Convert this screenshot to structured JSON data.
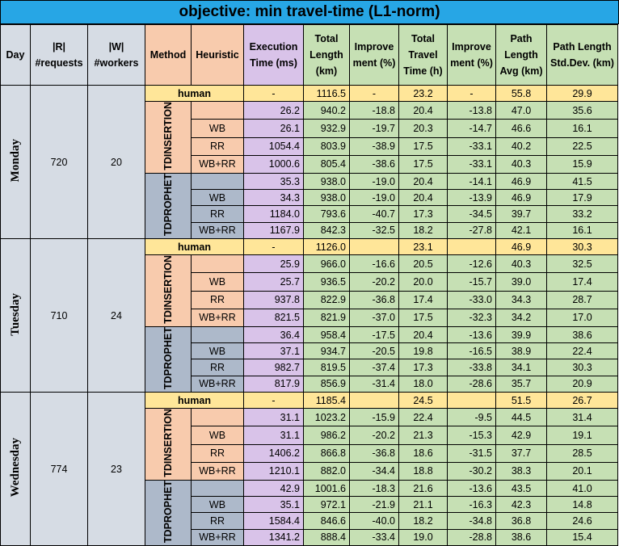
{
  "title": "objective:  min travel-time (L1-norm)",
  "headers": {
    "day": "Day",
    "requests": "|R| #requests",
    "workers": "|W| #workers",
    "method": "Method",
    "heuristic": "Heuristic",
    "exec": "Execution Time (ms)",
    "total_length": "Total Length (km)",
    "improvement_length": "Improve ment (%)",
    "total_travel": "Total Travel Time (h)",
    "improvement_time": "Improve ment (%)",
    "path_avg": "Path Length Avg (km)",
    "path_std": "Path Length Std.Dev. (km)"
  },
  "days": [
    {
      "day": "Monday",
      "requests": "720",
      "workers": "20",
      "human": {
        "label": "human",
        "exec": "-",
        "total_length": "1116.5",
        "imp_len": "-",
        "travel": "23.2",
        "imp_time": "-",
        "path_avg": "55.8",
        "path_std": "29.9"
      },
      "methods": [
        {
          "method": "TDINSERTION",
          "rows": [
            {
              "heuristic": "",
              "exec": "26.2",
              "total_length": "940.2",
              "imp_len": "-18.8",
              "travel": "20.4",
              "imp_time": "-13.8",
              "path_avg": "47.0",
              "path_std": "35.6"
            },
            {
              "heuristic": "WB",
              "exec": "26.1",
              "total_length": "932.9",
              "imp_len": "-19.7",
              "travel": "20.3",
              "imp_time": "-14.7",
              "path_avg": "46.6",
              "path_std": "16.1"
            },
            {
              "heuristic": "RR",
              "exec": "1054.4",
              "total_length": "803.9",
              "imp_len": "-38.9",
              "travel": "17.5",
              "imp_time": "-33.1",
              "path_avg": "40.2",
              "path_std": "22.5"
            },
            {
              "heuristic": "WB+RR",
              "exec": "1000.6",
              "total_length": "805.4",
              "imp_len": "-38.6",
              "travel": "17.5",
              "imp_time": "-33.1",
              "path_avg": "40.3",
              "path_std": "15.9"
            }
          ]
        },
        {
          "method": "TDPROPHET",
          "rows": [
            {
              "heuristic": "",
              "exec": "35.3",
              "total_length": "938.0",
              "imp_len": "-19.0",
              "travel": "20.4",
              "imp_time": "-14.1",
              "path_avg": "46.9",
              "path_std": "41.5"
            },
            {
              "heuristic": "WB",
              "exec": "34.3",
              "total_length": "938.0",
              "imp_len": "-19.0",
              "travel": "20.4",
              "imp_time": "-13.9",
              "path_avg": "46.9",
              "path_std": "17.9"
            },
            {
              "heuristic": "RR",
              "exec": "1184.0",
              "total_length": "793.6",
              "imp_len": "-40.7",
              "travel": "17.3",
              "imp_time": "-34.5",
              "path_avg": "39.7",
              "path_std": "33.2"
            },
            {
              "heuristic": "WB+RR",
              "exec": "1167.9",
              "total_length": "842.3",
              "imp_len": "-32.5",
              "travel": "18.2",
              "imp_time": "-27.8",
              "path_avg": "42.1",
              "path_std": "16.1"
            }
          ]
        }
      ]
    },
    {
      "day": "Tuesday",
      "requests": "710",
      "workers": "24",
      "human": {
        "label": "human",
        "exec": "-",
        "total_length": "1126.0",
        "imp_len": "",
        "travel": "23.1",
        "imp_time": "",
        "path_avg": "46.9",
        "path_std": "30.3"
      },
      "methods": [
        {
          "method": "TDINSERTION",
          "rows": [
            {
              "heuristic": "",
              "exec": "25.9",
              "total_length": "966.0",
              "imp_len": "-16.6",
              "travel": "20.5",
              "imp_time": "-12.6",
              "path_avg": "40.3",
              "path_std": "32.5"
            },
            {
              "heuristic": "WB",
              "exec": "25.7",
              "total_length": "936.5",
              "imp_len": "-20.2",
              "travel": "20.0",
              "imp_time": "-15.7",
              "path_avg": "39.0",
              "path_std": "17.4"
            },
            {
              "heuristic": "RR",
              "exec": "937.8",
              "total_length": "822.9",
              "imp_len": "-36.8",
              "travel": "17.4",
              "imp_time": "-33.0",
              "path_avg": "34.3",
              "path_std": "28.7"
            },
            {
              "heuristic": "WB+RR",
              "exec": "821.5",
              "total_length": "821.9",
              "imp_len": "-37.0",
              "travel": "17.5",
              "imp_time": "-32.3",
              "path_avg": "34.2",
              "path_std": "17.0"
            }
          ]
        },
        {
          "method": "TDPROPHET",
          "rows": [
            {
              "heuristic": "",
              "exec": "36.4",
              "total_length": "958.4",
              "imp_len": "-17.5",
              "travel": "20.4",
              "imp_time": "-13.6",
              "path_avg": "39.9",
              "path_std": "38.6"
            },
            {
              "heuristic": "WB",
              "exec": "37.1",
              "total_length": "934.7",
              "imp_len": "-20.5",
              "travel": "19.8",
              "imp_time": "-16.5",
              "path_avg": "38.9",
              "path_std": "22.4"
            },
            {
              "heuristic": "RR",
              "exec": "982.7",
              "total_length": "819.5",
              "imp_len": "-37.4",
              "travel": "17.3",
              "imp_time": "-33.8",
              "path_avg": "34.1",
              "path_std": "30.3"
            },
            {
              "heuristic": "WB+RR",
              "exec": "817.9",
              "total_length": "856.9",
              "imp_len": "-31.4",
              "travel": "18.0",
              "imp_time": "-28.6",
              "path_avg": "35.7",
              "path_std": "20.9"
            }
          ]
        }
      ]
    },
    {
      "day": "Wednesday",
      "requests": "774",
      "workers": "23",
      "human": {
        "label": "human",
        "exec": "-",
        "total_length": "1185.4",
        "imp_len": "",
        "travel": "24.5",
        "imp_time": "",
        "path_avg": "51.5",
        "path_std": "26.7"
      },
      "methods": [
        {
          "method": "TDINSERTION",
          "rows": [
            {
              "heuristic": "",
              "exec": "31.1",
              "total_length": "1023.2",
              "imp_len": "-15.9",
              "travel": "22.4",
              "imp_time": "-9.5",
              "path_avg": "44.5",
              "path_std": "31.4"
            },
            {
              "heuristic": "WB",
              "exec": "31.1",
              "total_length": "986.2",
              "imp_len": "-20.2",
              "travel": "21.3",
              "imp_time": "-15.3",
              "path_avg": "42.9",
              "path_std": "19.1"
            },
            {
              "heuristic": "RR",
              "exec": "1406.2",
              "total_length": "866.8",
              "imp_len": "-36.8",
              "travel": "18.6",
              "imp_time": "-31.5",
              "path_avg": "37.7",
              "path_std": "28.5"
            },
            {
              "heuristic": "WB+RR",
              "exec": "1210.1",
              "total_length": "882.0",
              "imp_len": "-34.4",
              "travel": "18.8",
              "imp_time": "-30.2",
              "path_avg": "38.3",
              "path_std": "20.1"
            }
          ]
        },
        {
          "method": "TDPROPHET",
          "rows": [
            {
              "heuristic": "",
              "exec": "42.9",
              "total_length": "1001.6",
              "imp_len": "-18.3",
              "travel": "21.6",
              "imp_time": "-13.6",
              "path_avg": "43.5",
              "path_std": "41.0"
            },
            {
              "heuristic": "WB",
              "exec": "35.1",
              "total_length": "972.1",
              "imp_len": "-21.9",
              "travel": "21.1",
              "imp_time": "-16.3",
              "path_avg": "42.3",
              "path_std": "14.8"
            },
            {
              "heuristic": "RR",
              "exec": "1584.4",
              "total_length": "846.6",
              "imp_len": "-40.0",
              "travel": "18.2",
              "imp_time": "-34.8",
              "path_avg": "36.8",
              "path_std": "24.6"
            },
            {
              "heuristic": "WB+RR",
              "exec": "1341.2",
              "total_length": "888.4",
              "imp_len": "-33.4",
              "travel": "19.0",
              "imp_time": "-28.8",
              "path_avg": "38.6",
              "path_std": "15.4"
            }
          ]
        }
      ]
    }
  ]
}
